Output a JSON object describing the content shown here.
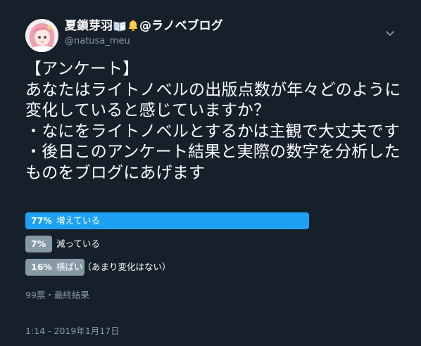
{
  "author": {
    "display_name_prefix": "夏鎖芽羽",
    "display_name_suffix": "@ラノベブログ",
    "emojis": [
      "open-book-emoji",
      "bell-emoji"
    ],
    "handle": "@natusa_meu"
  },
  "tweet": {
    "text": "【アンケート】\nあなたはライトノベルの出版点数が年々どのように変化していると感じていますか？\n・なにをライトノベルとするかは主観で大丈夫です\n・後日このアンケート結果と実際の数字を分析したものをブログにあげます"
  },
  "poll": {
    "options": [
      {
        "percent_label": "77%",
        "percent": 77,
        "label": "増えている",
        "winner": true
      },
      {
        "percent_label": "7%",
        "percent": 7,
        "label": "減っている",
        "winner": false
      },
      {
        "percent_label": "16%",
        "percent": 16,
        "label": "横ばい（あまり変化はない）",
        "winner": false
      }
    ],
    "footer": "99票・最終結果"
  },
  "timestamp": "1:14 - 2019年1月17日",
  "colors": {
    "background": "#15202b",
    "winner_bar": "#1da1f2",
    "other_bar": "#8899a6",
    "secondary_text": "#8899a6"
  },
  "icons": {
    "caret": "chevron-down-icon"
  }
}
